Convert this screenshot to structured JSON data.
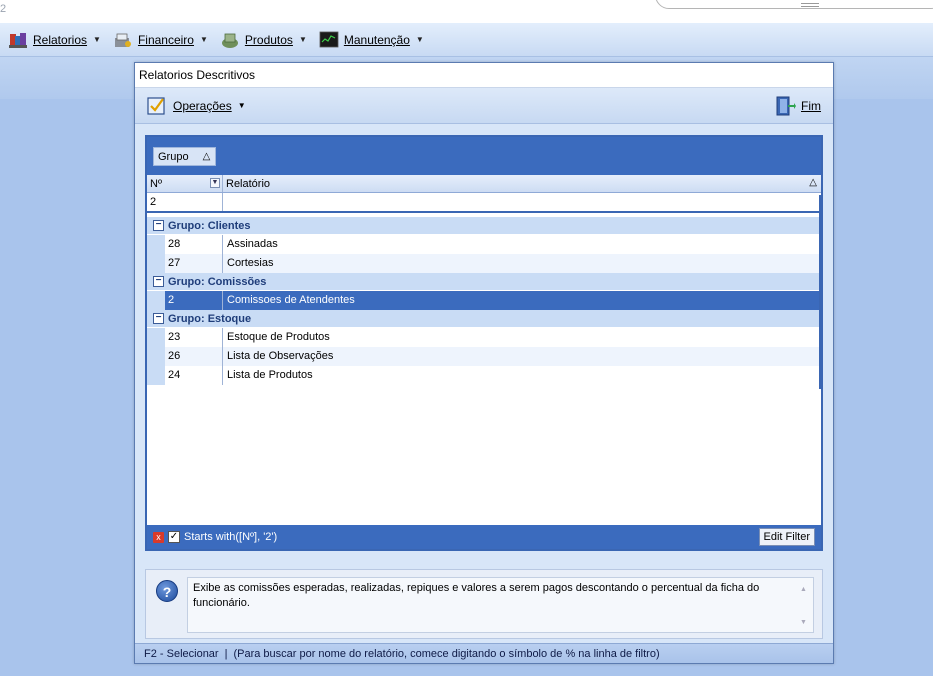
{
  "app": {
    "corner_text": "2"
  },
  "menubar": {
    "items": [
      {
        "label": "Relatorios",
        "icon": "reports-icon"
      },
      {
        "label": "Financeiro",
        "icon": "money-icon"
      },
      {
        "label": "Produtos",
        "icon": "products-icon"
      },
      {
        "label": "Manutenção",
        "icon": "monitor-icon"
      }
    ]
  },
  "dialog": {
    "title": "Relatorios Descritivos",
    "toolbar": {
      "operations_label": "Operações",
      "exit_label": "Fim"
    },
    "grid": {
      "group_button": "Grupo",
      "columns": {
        "n": "Nº",
        "relatorio": "Relatório"
      },
      "filter_value": "2",
      "groups": [
        {
          "title": "Grupo: Clientes",
          "rows": [
            {
              "n": "28",
              "rel": "Assinadas"
            },
            {
              "n": "27",
              "rel": "Cortesias"
            }
          ]
        },
        {
          "title": "Grupo: Comissões",
          "rows": [
            {
              "n": "2",
              "rel": "Comissoes de Atendentes",
              "selected": true
            }
          ]
        },
        {
          "title": "Grupo: Estoque",
          "rows": [
            {
              "n": "23",
              "rel": "Estoque de Produtos"
            },
            {
              "n": "26",
              "rel": "Lista de Observações"
            },
            {
              "n": "24",
              "rel": "Lista de Produtos"
            }
          ]
        }
      ],
      "filter_text": "Starts with([Nº], '2')",
      "edit_filter_label": "Edit Filter"
    },
    "description": "Exibe as comissões esperadas, realizadas, repiques e valores a serem pagos descontando o percentual da ficha do funcionário.",
    "status": {
      "shortcut": "F2 - Selecionar",
      "separator": "|",
      "hint": "(Para buscar por nome do relatório, comece digitando o símbolo de % na linha de filtro)"
    }
  }
}
